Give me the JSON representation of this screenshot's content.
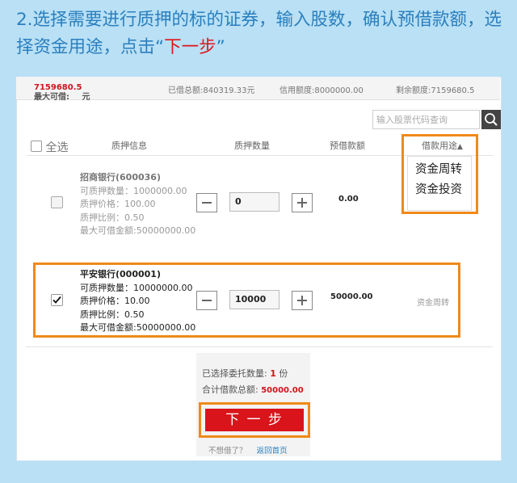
{
  "instruction": {
    "text": "2.选择需要进行质押的标的证券，输入股数，确认预借款额，选择资金用途，点击“",
    "highlight": "下一步",
    "suffix": "”"
  },
  "stats": {
    "max_label": "最大可借:",
    "max_value": "7159680.5",
    "max_unit": "元",
    "borrowed": "已借总额:840319.33元",
    "credit": "信用额度:8000000.00",
    "remaining": "剩余额度:7159680.5"
  },
  "search": {
    "placeholder": "输入股票代码查询"
  },
  "headers": {
    "select_all": "全选",
    "pledge_info": "质押信息",
    "pledge_qty": "质押数量",
    "pre_borrow": "预借款额",
    "loan_use": "借款用途"
  },
  "dropdown": {
    "options": [
      "资金周转",
      "资金投资"
    ]
  },
  "rows": [
    {
      "name": "招商银行(600036)",
      "pledgeable_qty": "可质押数量：1000000.00",
      "price": "质押价格：100.00",
      "ratio": "质押比例：0.50",
      "max_borrow": "最大可借金额:50000000.00",
      "quantity": "0",
      "amount": "0.00",
      "checked": false,
      "use": ""
    },
    {
      "name": "平安银行(000001)",
      "pledgeable_qty": "可质押数量：10000000.00",
      "price": "质押价格：10.00",
      "ratio": "质押比例：0.50",
      "max_borrow": "最大可借金额:50000000.00",
      "quantity": "10000",
      "amount": "50000.00",
      "checked": true,
      "use": "资金周转"
    }
  ],
  "summary": {
    "count_label": "已选择委托数量:",
    "count_value": "1",
    "count_unit": "份",
    "total_label": "合计借款总额:",
    "total_value": "50000.00"
  },
  "next_button": "下 一 步",
  "footer": {
    "not_borrow": "不想借了？",
    "back_home": "返回首页"
  },
  "colors": {
    "accent": "#2a7fbe",
    "highlight": "#ee8a1a",
    "brand_red": "#d9141b"
  }
}
